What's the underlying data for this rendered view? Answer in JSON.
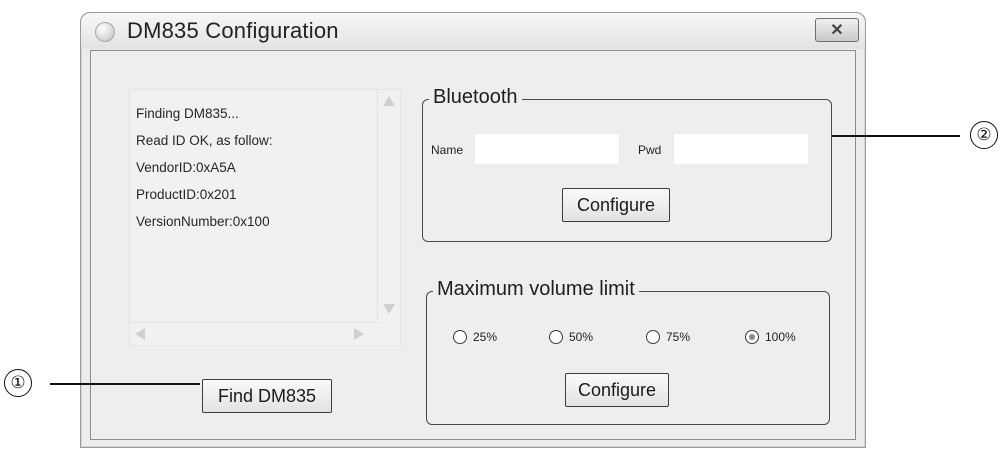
{
  "window": {
    "title": "DM835 Configuration",
    "close_glyph": "✕"
  },
  "log": {
    "lines": [
      "Finding DM835...",
      "Read ID OK, as follow:",
      "VendorID:0xA5A",
      "ProductID:0x201",
      "VersionNumber:0x100"
    ]
  },
  "find_button": {
    "label": "Find DM835"
  },
  "bluetooth": {
    "legend": "Bluetooth",
    "name_label": "Name",
    "name_value": "",
    "pwd_label": "Pwd",
    "pwd_value": "",
    "configure_label": "Configure"
  },
  "volume": {
    "legend": "Maximum volume limit",
    "options": [
      {
        "label": "25%",
        "selected": false
      },
      {
        "label": "50%",
        "selected": false
      },
      {
        "label": "75%",
        "selected": false
      },
      {
        "label": "100%",
        "selected": true
      }
    ],
    "configure_label": "Configure"
  },
  "callouts": {
    "one": "①",
    "two": "②"
  },
  "colors": {
    "dialog_bg": "#eeeeee",
    "titlebar_top": "#f7f7f7",
    "titlebar_bottom": "#e3e3e3",
    "border": "#4a4a4a",
    "selected_radio_dot": "#8a8a8a"
  }
}
